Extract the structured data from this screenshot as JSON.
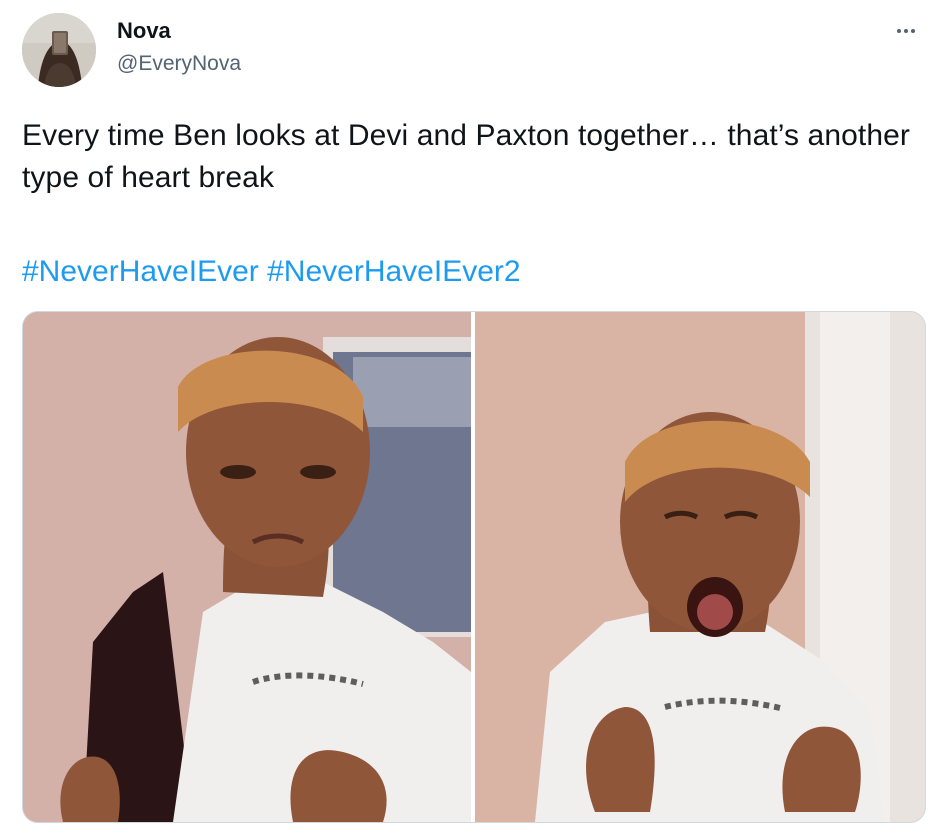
{
  "tweet": {
    "author": {
      "display_name": "Nova",
      "handle": "@EveryNova"
    },
    "text": "Every time Ben looks at Devi and Paxton together… that’s another type of heart break",
    "hashtags": [
      "#NeverHaveIEver",
      "#NeverHaveIEver2"
    ],
    "media": {
      "photos": [
        "crying-photo-left",
        "crying-photo-right"
      ]
    }
  },
  "icons": {
    "more": "more-horizontal-icon"
  },
  "colors": {
    "link": "#1d9bf0",
    "text": "#0f1419",
    "secondary_text": "#536471",
    "border": "#cfd9de"
  }
}
